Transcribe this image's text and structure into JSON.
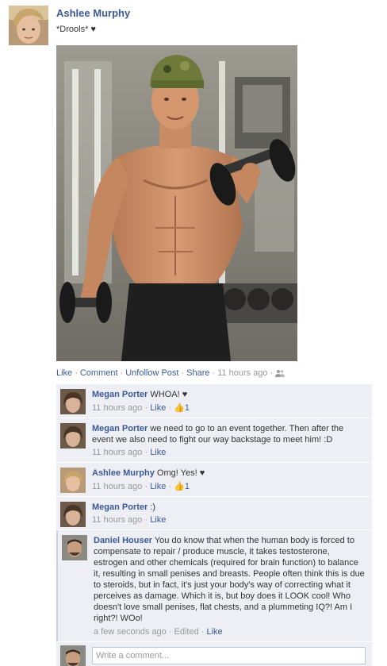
{
  "post": {
    "author": "Ashlee Murphy",
    "message": "*Drools* ♥",
    "actions": {
      "like": "Like",
      "comment": "Comment",
      "unfollow": "Unfollow Post",
      "share": "Share",
      "time": "11 hours ago"
    }
  },
  "comments": [
    {
      "author": "Megan Porter",
      "text": "WHOA! ♥",
      "time": "11 hours ago",
      "like": "Like",
      "likes": "1"
    },
    {
      "author": "Megan Porter",
      "text": "we need to go to an event together. Then after the event we also need to fight our way backstage to meet him! :D",
      "time": "11 hours ago",
      "like": "Like"
    },
    {
      "author": "Ashlee Murphy",
      "text": "Omg! Yes! ♥",
      "time": "11 hours ago",
      "like": "Like",
      "likes": "1"
    },
    {
      "author": "Megan Porter",
      "text": ":)",
      "time": "11 hours ago",
      "like": "Like"
    },
    {
      "author": "Daniel Houser",
      "text": "You do know that when the human body is forced to compensate to repair / produce muscle, it takes testosterone, estrogen and other chemicals (required for brain function) to balance it, resulting in small penises and breasts. People often think this is due to steroids, but in fact, it's just your body's way of correcting what it perceives as damage. Which it is, but boy does it LOOK cool! Who doesn't love small penises, flat chests, and a plummeting IQ?! Am I right?! WOo!",
      "time": "a few seconds ago",
      "edited": "Edited",
      "like": "Like"
    }
  ],
  "composer": {
    "placeholder": "Write a comment..."
  },
  "icons": {
    "like_icon": "thumbs-up-icon",
    "privacy_icon": "friends-icon"
  },
  "colors": {
    "link": "#3b5998",
    "comment_bg": "#edeff4",
    "meta": "#999999"
  }
}
